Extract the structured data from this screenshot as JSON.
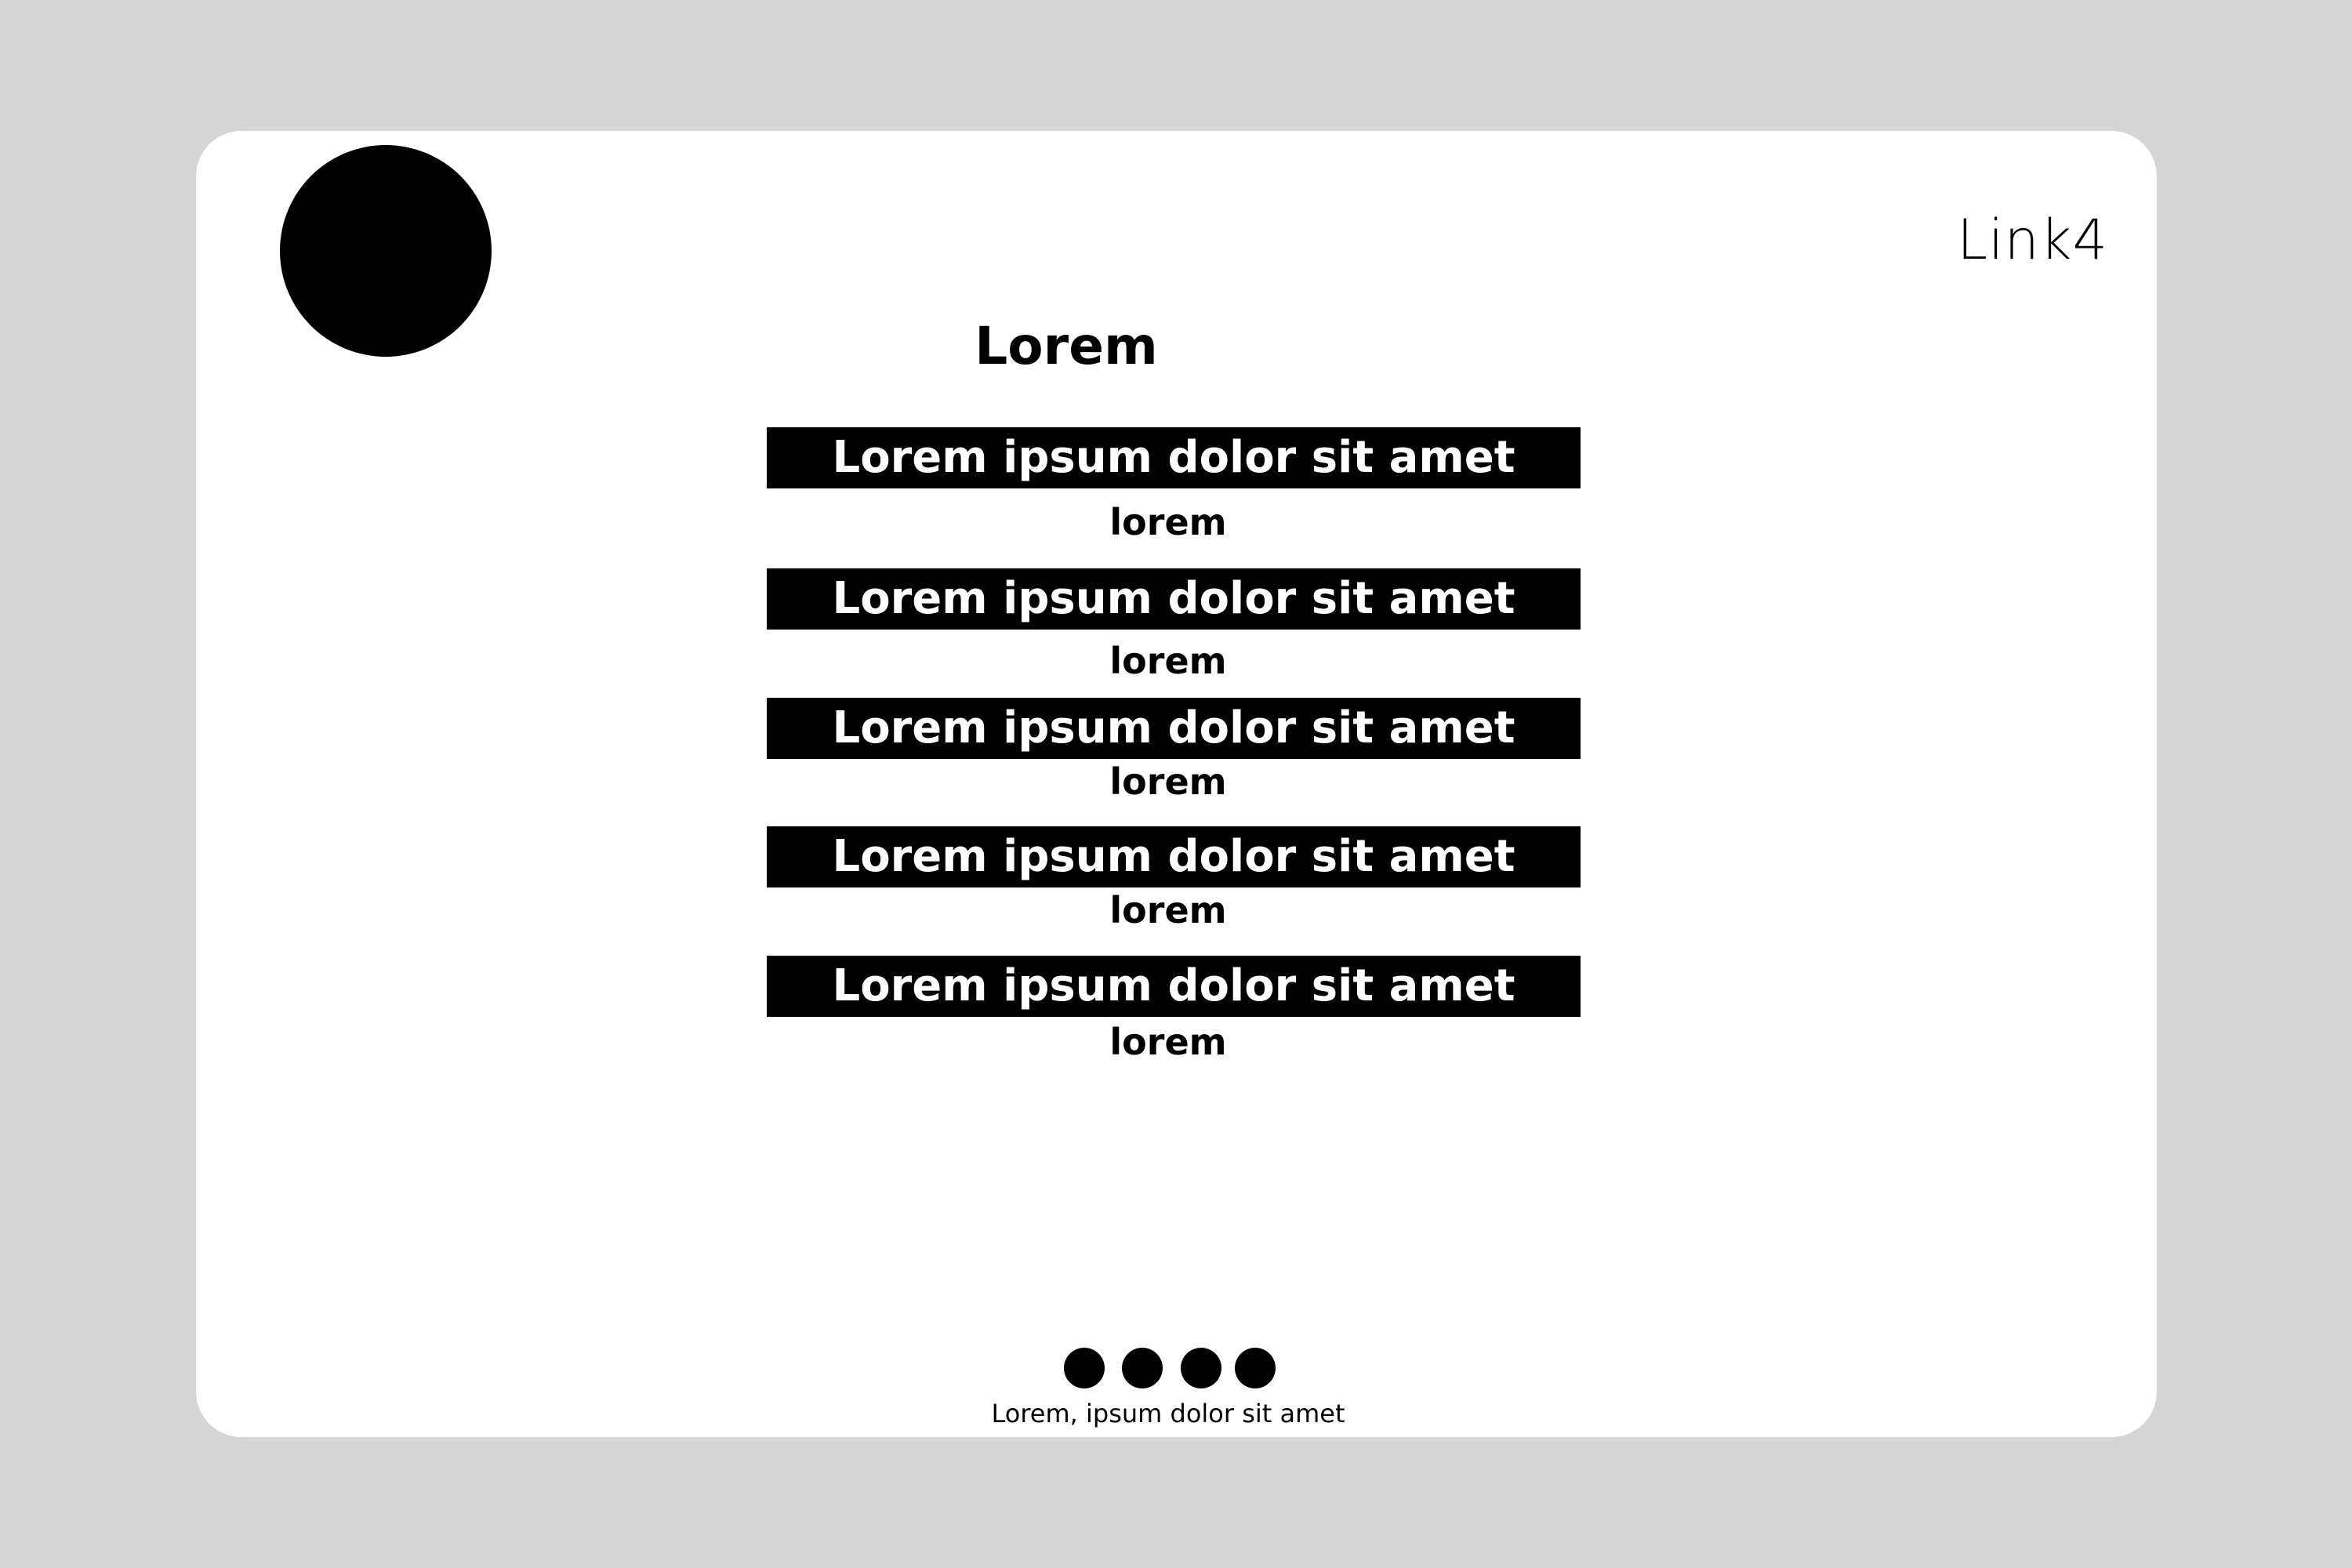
{
  "nav": {
    "link4_label": "Link4"
  },
  "main": {
    "heading": "Lorem",
    "items": [
      {
        "title": "Lorem ipsum dolor sit amet",
        "subtitle": "lorem"
      },
      {
        "title": "Lorem ipsum dolor sit amet",
        "subtitle": "lorem"
      },
      {
        "title": "Lorem ipsum dolor sit amet",
        "subtitle": "lorem"
      },
      {
        "title": "Lorem ipsum dolor sit amet",
        "subtitle": "lorem"
      },
      {
        "title": "Lorem ipsum dolor sit amet",
        "subtitle": "lorem"
      }
    ]
  },
  "footer": {
    "text": "Lorem, ipsum dolor sit amet",
    "social_icons": [
      "social-icon",
      "social-icon",
      "social-icon",
      "social-icon"
    ]
  },
  "colors": {
    "page_background": "#d6d6d6",
    "card_background": "#ffffff",
    "accent": "#000000",
    "bar_text": "#ffffff"
  }
}
